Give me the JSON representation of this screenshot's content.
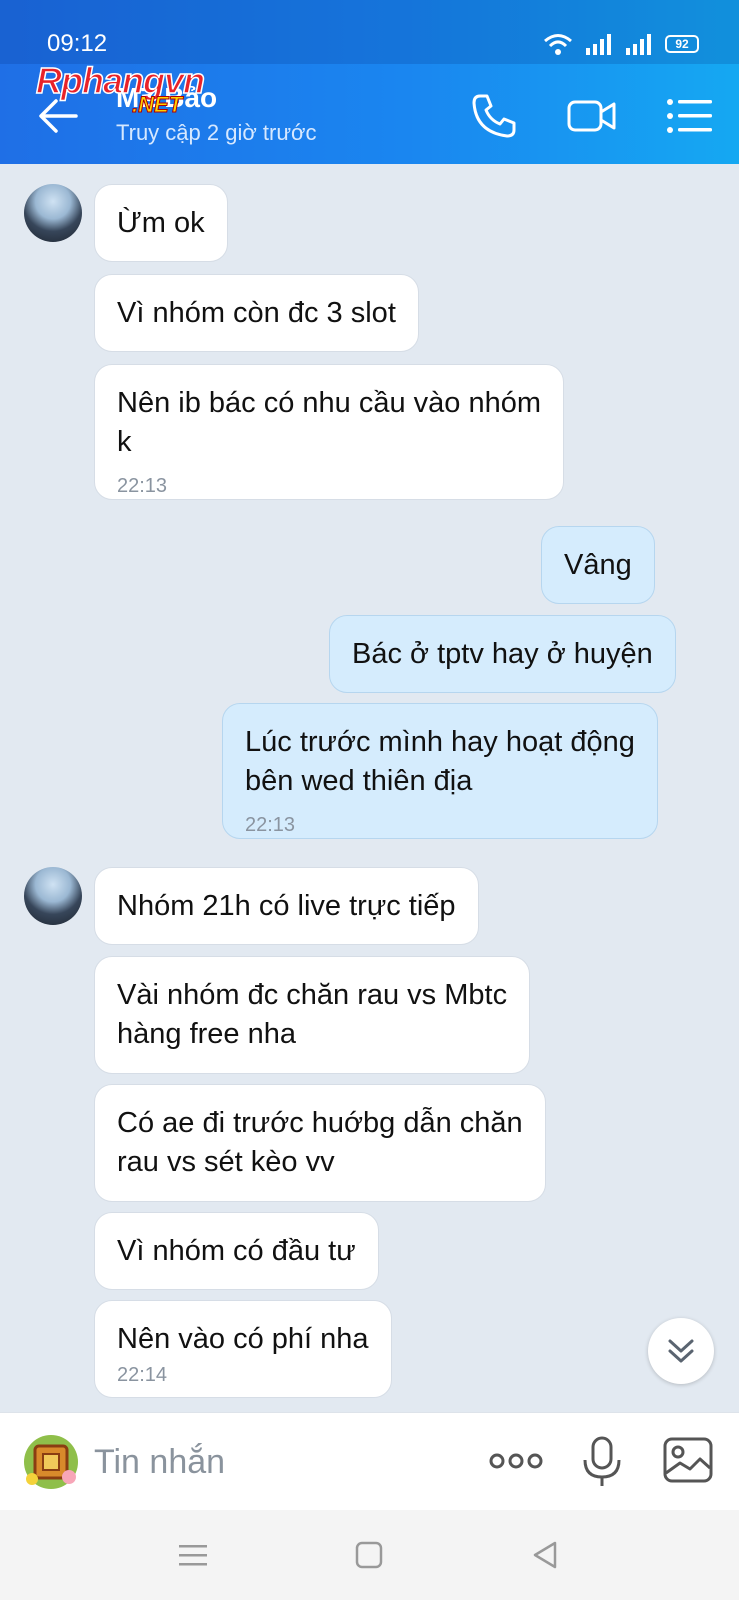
{
  "status_bar": {
    "time": "09:12",
    "battery": "92"
  },
  "watermark": {
    "main": "Rphangvn",
    "sub": ".NET"
  },
  "header": {
    "contact_name": "MZ Bảo",
    "contact_status": "Truy cập 2 giờ trước",
    "icons": [
      "back-arrow-icon",
      "phone-icon",
      "video-camera-icon",
      "menu-list-icon"
    ],
    "accent_color": "#1a86f0"
  },
  "messages": [
    {
      "text": "Ừm ok"
    },
    {
      "text": "Vì nhóm còn đc 3 slot"
    },
    {
      "text": "Nên ib bác có nhu cầu vào nhóm\nk",
      "time": "22:13"
    },
    {
      "text": "Vâng"
    },
    {
      "text": "Bác ở tptv hay ở huyện"
    },
    {
      "text": "Lúc trước mình hay hoạt động\nbên wed thiên địa",
      "time": "22:13"
    },
    {
      "text": "Nhóm 21h có live trực tiếp"
    },
    {
      "text": "Vài nhóm đc chăn rau vs Mbtc\nhàng free nha"
    },
    {
      "text": "Có ae đi trước huớbg dẫn chăn\nrau vs sét kèo vv"
    },
    {
      "text": "Vì nhóm có đầu tư"
    },
    {
      "text": "Nên vào có phí nha",
      "time": "22:14"
    }
  ],
  "input_bar": {
    "placeholder": "Tin nhắn",
    "icons": [
      "sticker-icon",
      "more-dots-icon",
      "microphone-icon",
      "image-icon"
    ]
  },
  "nav_bar": {
    "icons": [
      "menu-icon",
      "home-square-icon",
      "back-triangle-icon"
    ]
  }
}
